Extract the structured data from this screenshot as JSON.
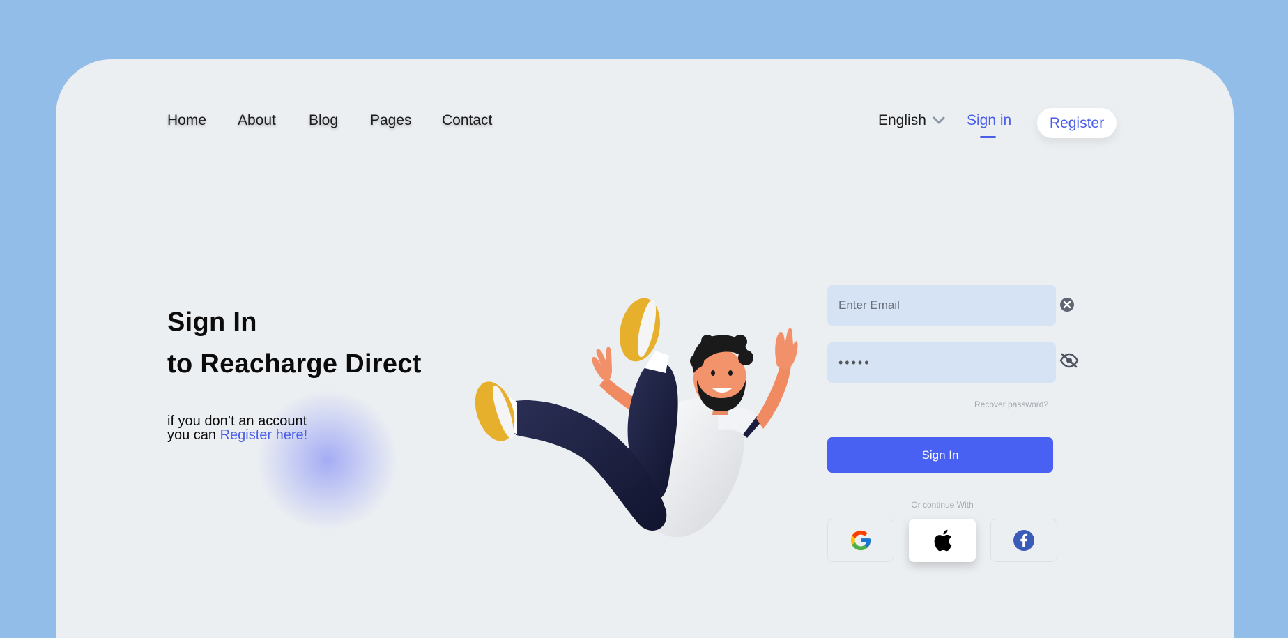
{
  "nav": {
    "items": [
      "Home",
      "About",
      "Blog",
      "Pages",
      "Contact"
    ],
    "language": "English",
    "signin": "Sign in",
    "register": "Register"
  },
  "hero": {
    "title_line1": "Sign In",
    "title_line2": "to Reacharge Direct",
    "sub_line1": "if you don’t an account",
    "sub_prefix": "you can ",
    "sub_link": "Register here!"
  },
  "form": {
    "email_placeholder": "Enter Email",
    "password_value": "•••••",
    "recover": "Recover password?",
    "signin_button": "Sign In",
    "or_text": "Or continue With"
  },
  "colors": {
    "accent": "#4961f2",
    "page_bg": "#91bde8",
    "card_bg": "#eceff2",
    "input_bg": "#d6e3f4"
  },
  "icons": [
    "clear-icon",
    "eye-off-icon",
    "chevron-down-icon",
    "google-icon",
    "apple-icon",
    "facebook-icon"
  ]
}
